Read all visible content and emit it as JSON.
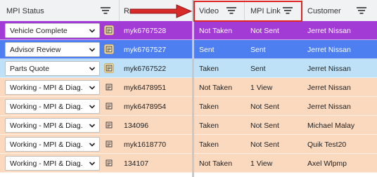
{
  "columns": {
    "status": "MPI Status",
    "ro_partial": "R",
    "video": "Video",
    "mpi_link": "MPI Link",
    "customer": "Customer"
  },
  "colors": {
    "purple": "#a23bd6",
    "blue": "#4d7ff0",
    "light_blue": "#bfe1f7",
    "peach": "#fbd9bf",
    "highlight_border": "#e02525",
    "arrow": "#d92a2a"
  },
  "rows": [
    {
      "status": "Vehicle Complete",
      "ro": "myk6767528",
      "video": "Not Taken",
      "mpi": "Not Sent",
      "customer": "Jerret Nissan",
      "tone": "purple",
      "text": "light"
    },
    {
      "status": "Advisor Review",
      "ro": "myk6767527",
      "video": "Sent",
      "mpi": "Sent",
      "customer": "Jerret Nissan",
      "tone": "blue",
      "text": "light"
    },
    {
      "status": "Parts Quote",
      "ro": "myk6767522",
      "video": "Taken",
      "mpi": "Sent",
      "customer": "Jerret Nissan",
      "tone": "light_blue",
      "text": "dark"
    },
    {
      "status": "Working - MPI & Diag.",
      "ro": "myk6478951",
      "video": "Not Taken",
      "mpi": "1 View",
      "customer": "Jerret Nissan",
      "tone": "peach",
      "text": "dark"
    },
    {
      "status": "Working - MPI & Diag.",
      "ro": "myk6478954",
      "video": "Taken",
      "mpi": "Not Sent",
      "customer": "Jerret Nissan",
      "tone": "peach",
      "text": "dark"
    },
    {
      "status": "Working - MPI & Diag.",
      "ro": "134096",
      "video": "Taken",
      "mpi": "Not Sent",
      "customer": "Michael Malay",
      "tone": "peach",
      "text": "dark"
    },
    {
      "status": "Working - MPI & Diag.",
      "ro": "myk1618770",
      "video": "Taken",
      "mpi": "Not Sent",
      "customer": "Quik Test20",
      "tone": "peach",
      "text": "dark"
    },
    {
      "status": "Working - MPI & Diag.",
      "ro": "134107",
      "video": "Not Taken",
      "mpi": "1 View",
      "customer": "Axel Wlpmp",
      "tone": "peach",
      "text": "dark"
    }
  ]
}
